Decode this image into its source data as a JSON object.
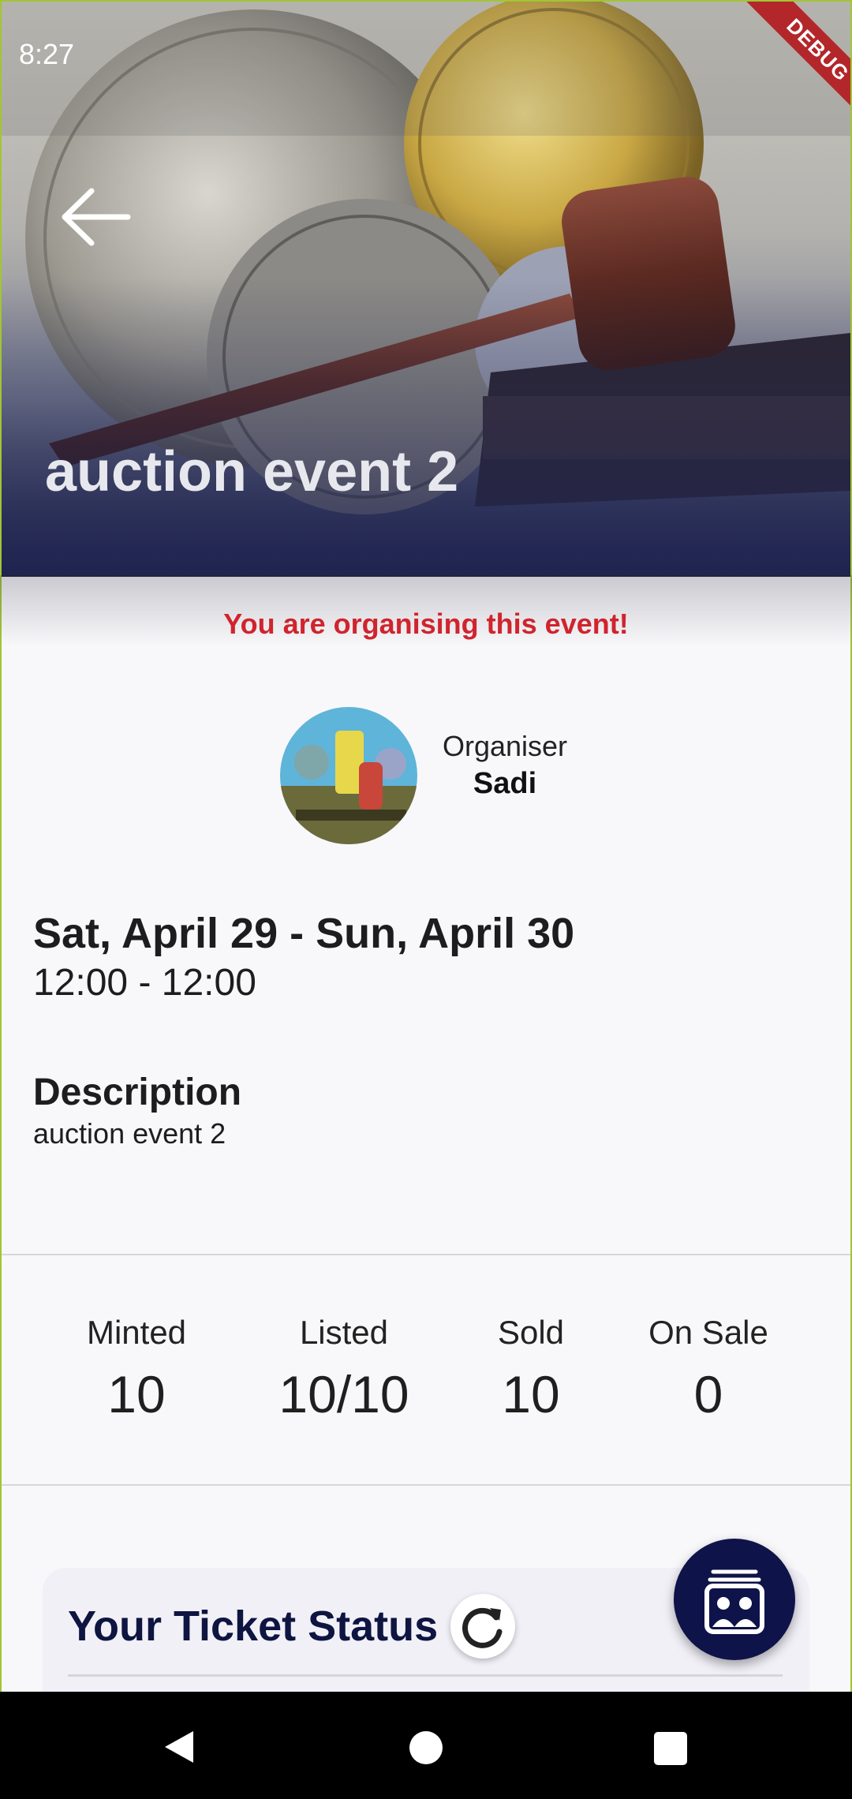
{
  "status_bar": {
    "time": "8:27"
  },
  "debug_banner": "DEBUG",
  "event": {
    "title": "auction event 2",
    "organising_notice": "You are organising this event!",
    "organiser": {
      "label": "Organiser",
      "name": "Sadi"
    },
    "dates": "Sat, April 29 - Sun, April 30",
    "times": "12:00 - 12:00",
    "description_title": "Description",
    "description": "auction event 2"
  },
  "stats": [
    {
      "label": "Minted",
      "value": "10"
    },
    {
      "label": "Listed",
      "value": "10/10"
    },
    {
      "label": "Sold",
      "value": "10"
    },
    {
      "label": "On Sale",
      "value": "0"
    }
  ],
  "ticket_status": {
    "title": "Your Ticket Status"
  },
  "icons": {
    "back": "arrow-back-icon",
    "refresh": "refresh-icon",
    "tickets": "ticket-wallet-icon"
  },
  "colors": {
    "accent_red": "#d0242d",
    "fab_navy": "#0e1449",
    "frame_green": "#a2c535"
  }
}
